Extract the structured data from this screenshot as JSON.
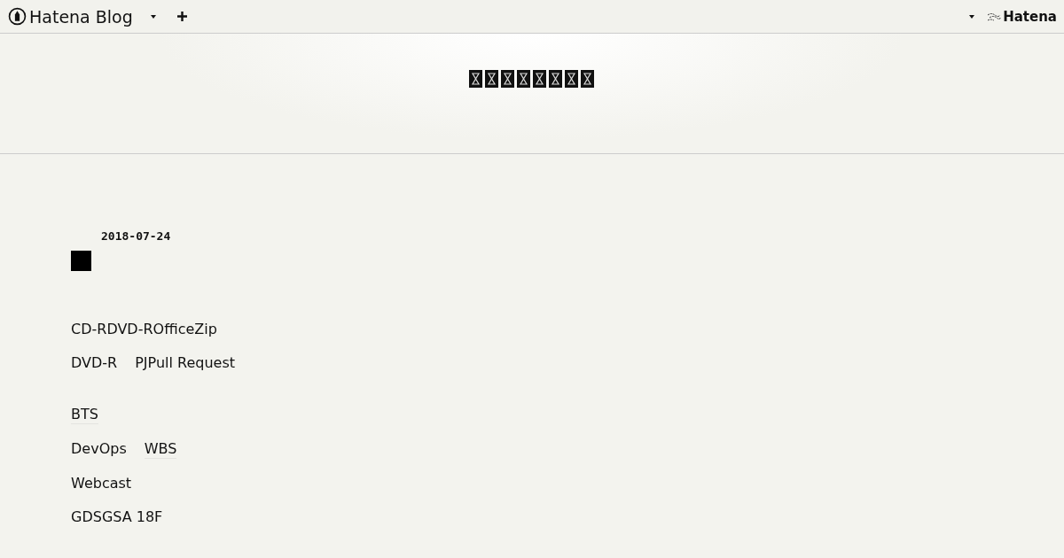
{
  "header": {
    "logo_text": "Hatena Blog",
    "right_logo_text": "Hatena"
  },
  "entry": {
    "date": "2018-07-24",
    "groups": [
      [
        [
          {
            "text": "CD-RDVD-ROfficeZip",
            "link": false
          }
        ],
        [
          {
            "text": "DVD-R",
            "link": false
          },
          {
            "text": "PJPull Request",
            "link": false
          }
        ]
      ],
      [
        [
          {
            "text": "BTS",
            "link": true
          }
        ],
        [
          {
            "text": "DevOps",
            "link": false
          },
          {
            "text": "WBS",
            "link": true
          }
        ],
        [
          {
            "text": "Webcast",
            "link": false
          }
        ],
        [
          {
            "text": "GDSGSA 18F",
            "link": false
          }
        ]
      ]
    ]
  }
}
